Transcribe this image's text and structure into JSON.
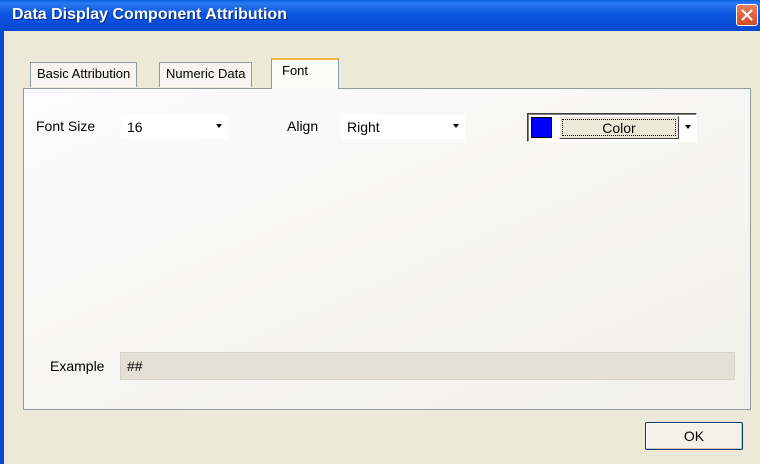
{
  "window": {
    "title": "Data Display Component Attribution"
  },
  "tabs": [
    {
      "label": "Basic Attribution",
      "active": false
    },
    {
      "label": "Numeric Data",
      "active": false
    },
    {
      "label": "Font",
      "active": true
    }
  ],
  "font_tab": {
    "font_size": {
      "label": "Font Size",
      "value": "16"
    },
    "align": {
      "label": "Align",
      "value": "Right"
    },
    "color": {
      "label": "Color",
      "swatch": "#0000ff"
    },
    "example": {
      "label": "Example",
      "value": "##"
    }
  },
  "buttons": {
    "ok": "OK"
  },
  "colors": {
    "titlebar": "#0848d2",
    "dialog_bg": "#ece9d8",
    "active_tab_accent": "#f3b83c"
  }
}
